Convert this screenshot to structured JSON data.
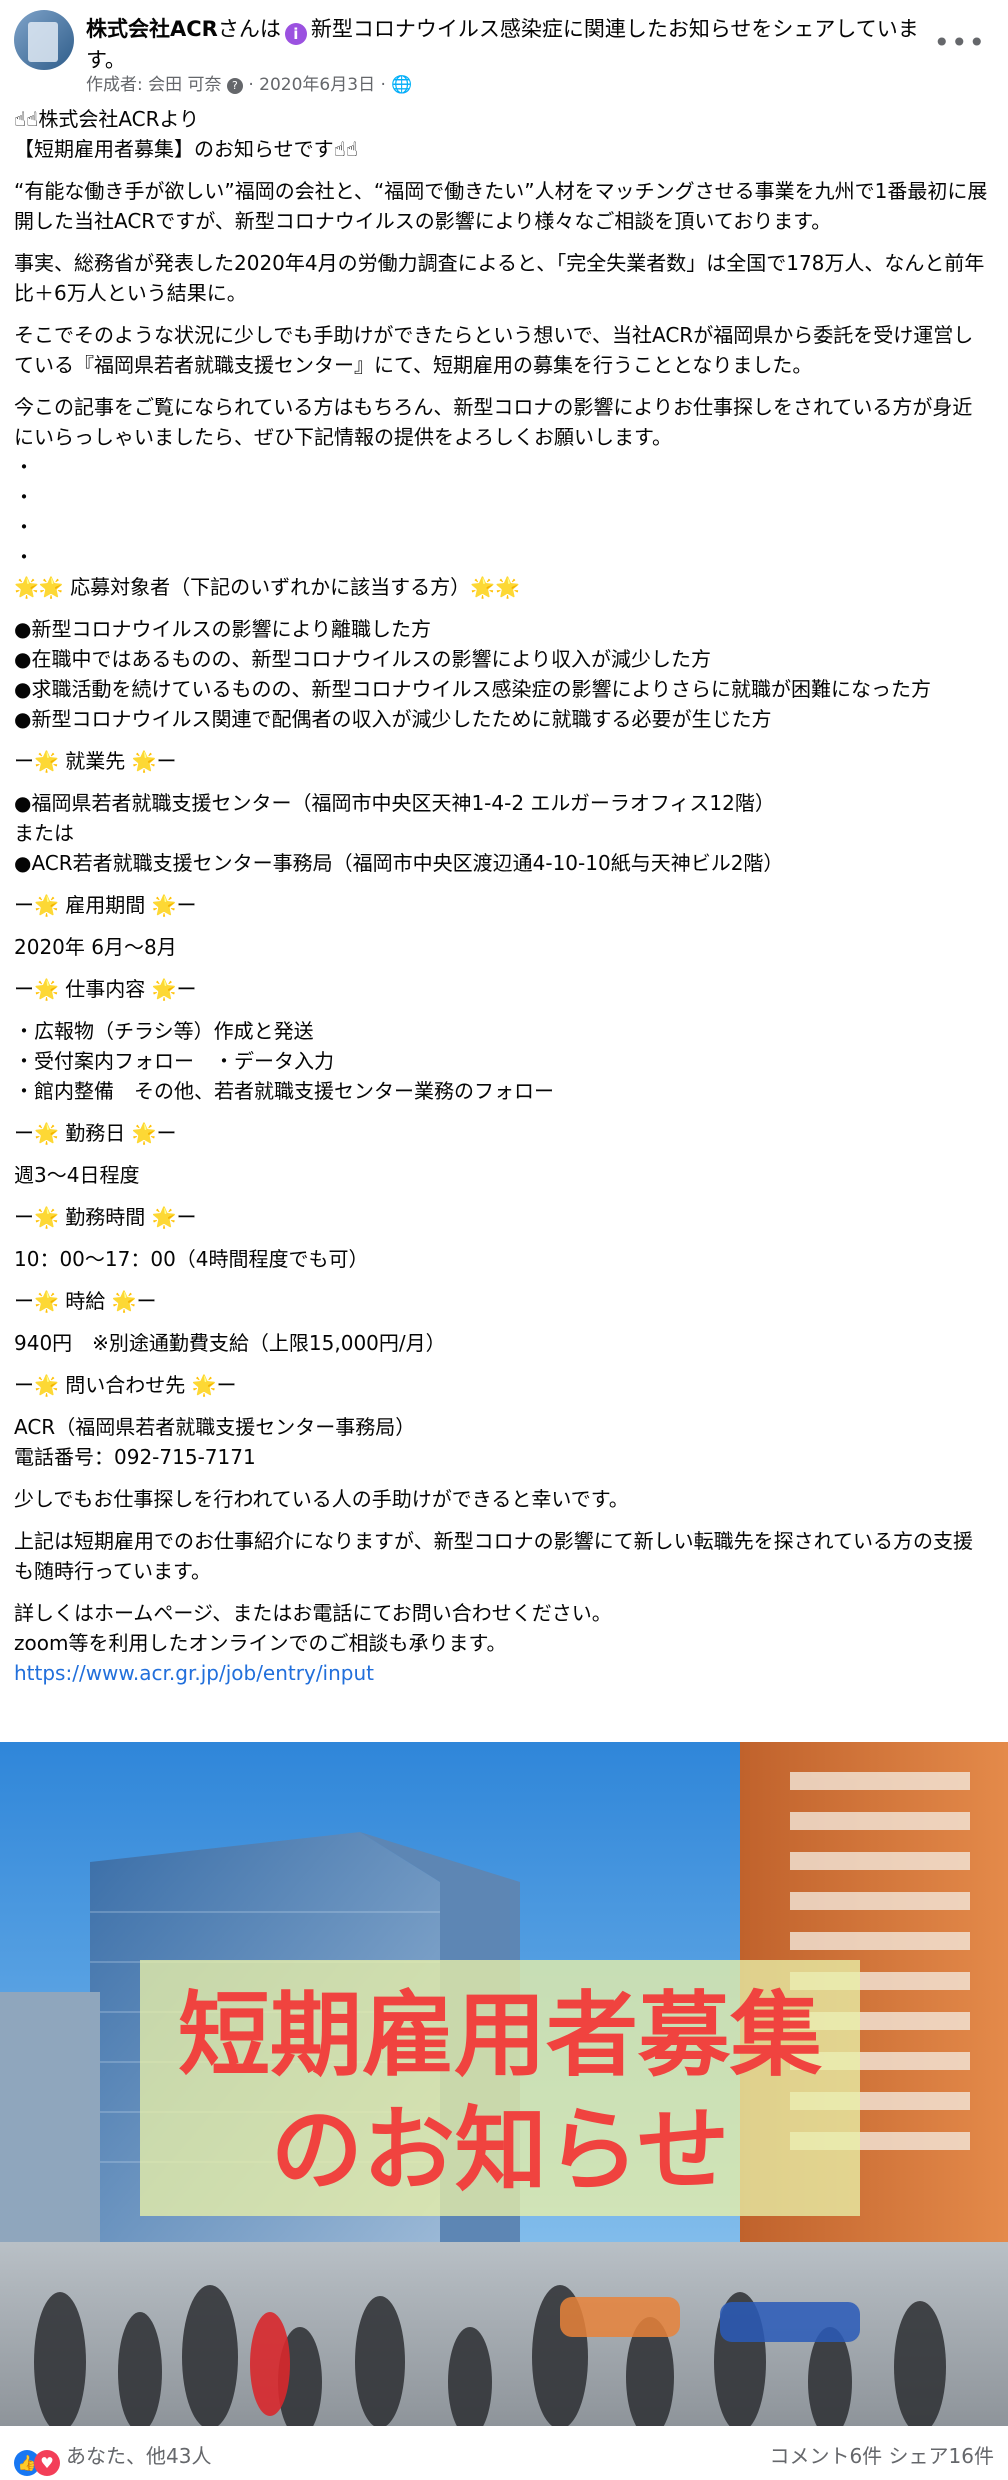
{
  "post": {
    "author": "株式会社ACR",
    "header_suffix": "さんは",
    "header_action": "新型コロナウイルス感染症に関連したお知らせをシェアしています。",
    "meta_author": "作成者: 会田 可奈",
    "date": "2020年6月3日",
    "more": "•••"
  },
  "content": {
    "intro1": "☝☝株式会社ACRより",
    "intro2": "【短期雇用者募集】のお知らせです☝☝",
    "p1": "“有能な働き手が欲しい”福岡の会社と、“福岡で働きたい”人材をマッチングさせる事業を九州で1番最初に展開した当社ACRですが、新型コロナウイルスの影響により様々なご相談を頂いております。",
    "p2": "事実、総務省が発表した2020年4月の労働力調査によると、「完全失業者数」は全国で178万人、なんと前年比＋6万人という結果に。",
    "p3": "そこでそのような状況に少しでも手助けができたらという想いで、当社ACRが福岡県から委託を受け運営している『福岡県若者就職支援センター』にて、短期雇用の募集を行うこととなりました。",
    "p4": "今この記事をご覧になられている方はもちろん、新型コロナの影響によりお仕事探しをされている方が身近にいらっしゃいましたら、ぜひ下記情報の提供をよろしくお願いします。",
    "dot": "・",
    "target_heading": "🌟🌟 応募対象者（下記のいずれかに該当する方）🌟🌟",
    "target1": "●新型コロナウイルスの影響により離職した方",
    "target2": "●在職中ではあるものの、新型コロナウイルスの影響により収入が減少した方",
    "target3": "●求職活動を続けているものの、新型コロナウイルス感染症の影響によりさらに就職が困難になった方",
    "target4": "●新型コロナウイルス関連で配偶者の収入が減少したために就職する必要が生じた方",
    "place_heading": "ー🌟 就業先 🌟ー",
    "place1": "●福岡県若者就職支援センター（福岡市中央区天神1-4-2 エルガーラオフィス12階）",
    "place_or": "または",
    "place2": "●ACR若者就職支援センター事務局（福岡市中央区渡辺通4-10-10紙与天神ビル2階）",
    "period_heading": "ー🌟 雇用期間 🌟ー",
    "period": "2020年 6月～8月",
    "work_heading": "ー🌟 仕事内容 🌟ー",
    "work1": "・広報物（チラシ等）作成と発送",
    "work2": "・受付案内フォロー　・データ入力",
    "work3": "・館内整備　その他、若者就職支援センター業務のフォロー",
    "days_heading": "ー🌟 勤務日 🌟ー",
    "days": "週3～4日程度",
    "hours_heading": "ー🌟 勤務時間 🌟ー",
    "hours": "10：00～17：00（4時間程度でも可）",
    "wage_heading": "ー🌟 時給 🌟ー",
    "wage": "940円　※別途通勤費支給（上限15,000円/月）",
    "contact_heading": "ー🌟 問い合わせ先 🌟ー",
    "contact1": "ACR（福岡県若者就職支援センター事務局）",
    "contact2": "電話番号：092-715-7171",
    "close1": "少しでもお仕事探しを行われている人の手助けができると幸いです。",
    "close2": "上記は短期雇用でのお仕事紹介になりますが、新型コロナの影響にて新しい転職先を探されている方の支援も随時行っています。",
    "close3": "詳しくはホームページ、またはお電話にてお問い合わせください。",
    "close4": "zoom等を利用したオンラインでのご相談も承ります。",
    "link": "https://www.acr.gr.jp/job/entry/input"
  },
  "image": {
    "line1": "短期雇用者募集",
    "line2": "のお知らせ",
    "text_color": "#f0433f"
  },
  "footer": {
    "like_icon": "👍",
    "love_icon": "♥",
    "reactions": "あなた、他43人",
    "comments": "コメント6件",
    "shares": "シェア16件"
  }
}
